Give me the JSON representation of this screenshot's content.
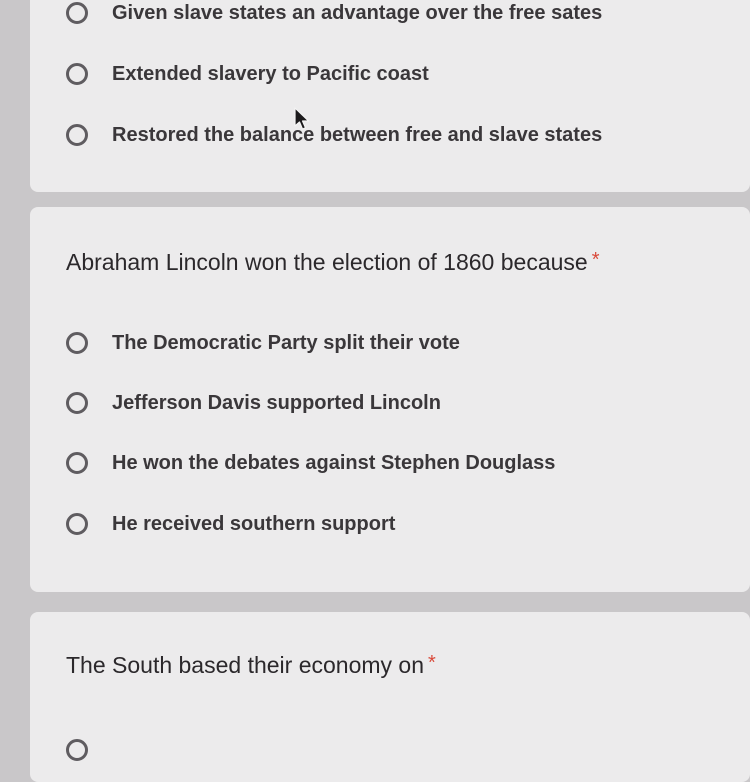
{
  "questions": [
    {
      "title": "",
      "required": false,
      "options": [
        "Given slave states an advantage over the free sates",
        "Extended slavery to Pacific coast",
        "Restored the balance between free and slave states"
      ]
    },
    {
      "title": "Abraham Lincoln won the election of 1860 because",
      "required": true,
      "required_marker": "*",
      "options": [
        "The Democratic Party split their vote",
        "Jefferson Davis supported Lincoln",
        "He won the debates against Stephen Douglass",
        "He received southern support"
      ]
    },
    {
      "title": "The South based their economy on",
      "required": true,
      "required_marker": "*",
      "options": [
        ""
      ]
    }
  ],
  "colors": {
    "page_background": "#c9c7c9",
    "card_background": "#ecebec",
    "required_star": "#d9493a",
    "radio_border": "#5f5c60"
  },
  "icons": {
    "cursor": "mouse-pointer-icon"
  }
}
